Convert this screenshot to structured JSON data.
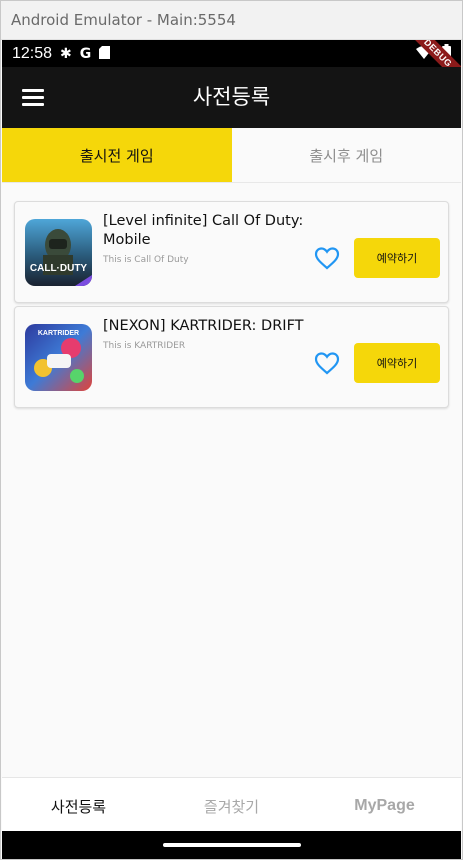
{
  "window": {
    "title": "Android Emulator - Main:5554"
  },
  "status_bar": {
    "time": "12:58",
    "debug_label": "DEBUG"
  },
  "app_bar": {
    "title": "사전등록"
  },
  "tabs": [
    {
      "label": "출시전 게임",
      "active": true
    },
    {
      "label": "출시후 게임",
      "active": false
    }
  ],
  "games": [
    {
      "title": "[Level infinite] Call Of Duty: Mobile",
      "description": "This is Call Of Duty",
      "reserve_label": "예약하기",
      "thumb_text": "CALL·DUTY"
    },
    {
      "title": "[NEXON] KARTRIDER: DRIFT",
      "description": "This is KARTRIDER",
      "reserve_label": "예약하기",
      "thumb_text": "KARTRIDER"
    }
  ],
  "bottom_nav": [
    {
      "label": "사전등록",
      "active": true
    },
    {
      "label": "즐겨찾기",
      "active": false
    },
    {
      "label": "MyPage",
      "active": false
    }
  ],
  "colors": {
    "accent": "#f5d70a",
    "appbar": "#141414",
    "heart": "#2196f3"
  }
}
